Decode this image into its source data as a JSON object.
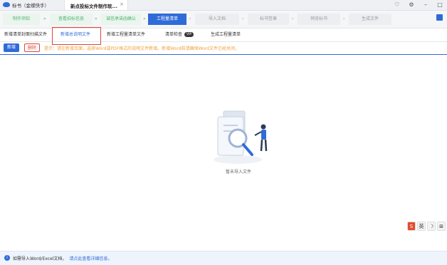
{
  "app": {
    "title": "标书（金蝶快手）"
  },
  "tab": {
    "label": "新点投标文件制作软...",
    "close": "×"
  },
  "window_icons": [
    "bell-icon",
    "settings-icon",
    "minimize-icon",
    "restore-icon"
  ],
  "steps": [
    {
      "label": "制作须知",
      "state": "done"
    },
    {
      "label": "查看招标信息",
      "state": "done"
    },
    {
      "label": "诚信承诺函确认",
      "state": "done"
    },
    {
      "label": "工程量清单",
      "state": "active"
    },
    {
      "label": "导入文档",
      "state": "todo"
    },
    {
      "label": "标书签章",
      "state": "todo"
    },
    {
      "label": "预览标书",
      "state": "todo"
    },
    {
      "label": "生成文件",
      "state": "todo"
    }
  ],
  "subtabs": [
    {
      "label": "新增清单封面扫描文件",
      "active": false
    },
    {
      "label": "新增总说明文件",
      "active": true
    },
    {
      "label": "新增工程量清单文件",
      "active": false
    },
    {
      "label": "清单检查",
      "active": false,
      "badge": "VIP"
    },
    {
      "label": "生成工程量清单",
      "active": false
    }
  ],
  "toolbar": {
    "new_label": "新增",
    "delete_label": "删除",
    "tip": "提示：请在新增页面，选择Word或PDF格式的说明文件新增。新增Word前请确保Word文件已经关闭。"
  },
  "empty": {
    "text": "暂未导入文件"
  },
  "ime": [
    "S",
    "英",
    "☽",
    "⊞"
  ],
  "footer": {
    "text": "如需导入Word/Excel文档，",
    "link": "请点此查看详细信息。"
  },
  "colors": {
    "accent": "#2f6bd8",
    "done": "#4fb36d",
    "danger": "#e0453a",
    "tip": "#f0a03a"
  }
}
